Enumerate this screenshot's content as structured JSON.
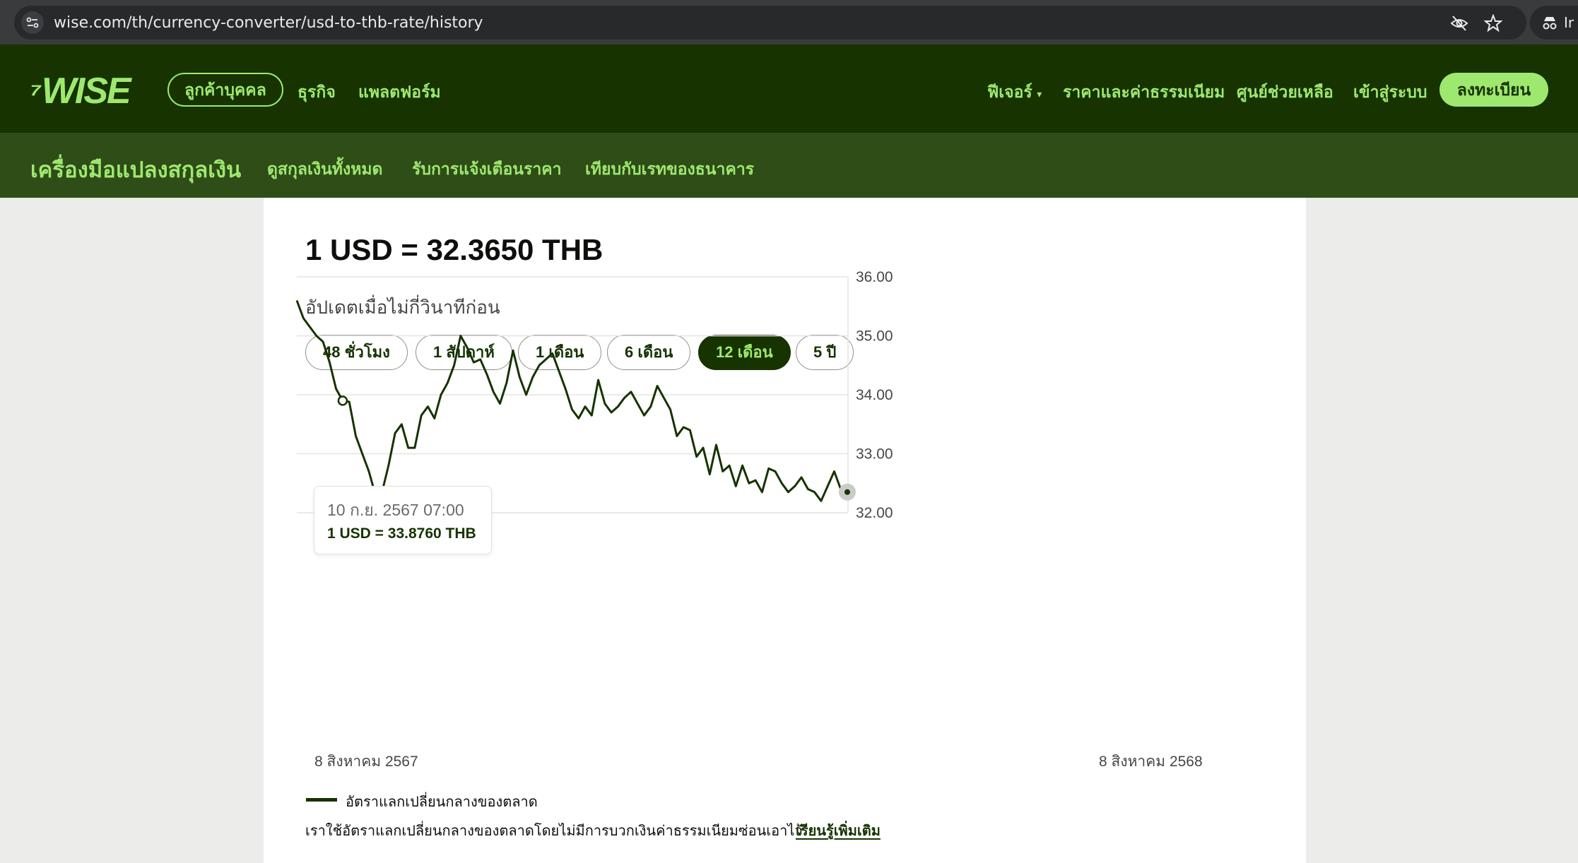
{
  "browser": {
    "url": "wise.com/th/currency-converter/usd-to-thb-rate/history",
    "profile_label": "Ir"
  },
  "nav": {
    "logo": "WISE",
    "personal": "ลูกค้าบุคคล",
    "business": "ธุรกิจ",
    "platform": "แพลตฟอร์ม",
    "features": "ฟีเจอร์",
    "pricing": "ราคาและค่าธรรมเนียม",
    "help": "ศูนย์ช่วยเหลือ",
    "login": "เข้าสู่ระบบ",
    "signup": "ลงทะเบียน"
  },
  "subnav": {
    "title": "เครื่องมือแปลงสกุลเงิน",
    "all_currencies": "ดูสกุลเงินทั้งหมด",
    "alerts": "รับการแจ้งเตือนราคา",
    "compare": "เทียบกับเรทของธนาคาร"
  },
  "rate": {
    "title": "1 USD = 32.3650 THB",
    "updated": "อัปเดตเมื่อไม่กี่วินาทีก่อน"
  },
  "ranges": [
    {
      "label": "48 ชั่วโมง",
      "active": false
    },
    {
      "label": "1 สัปดาห์",
      "active": false
    },
    {
      "label": "1 เดือน",
      "active": false
    },
    {
      "label": "6 เดือน",
      "active": false
    },
    {
      "label": "12 เดือน",
      "active": true
    },
    {
      "label": "5 ปี",
      "active": false
    }
  ],
  "tooltip": {
    "date": "10 ก.ย. 2567 07:00",
    "value": "1 USD = 33.8760 THB"
  },
  "legend": "อัตราแลกเปลี่ยนกลางของตลาด",
  "note": "เราใช้อัตราแลกเปลี่ยนกลางของตลาดโดยไม่มีการบวกเงินค่าธรรมเนียมซ่อนเอาไว้",
  "learn_more": "เรียนรู้เพิ่มเติม",
  "colors": {
    "brand_dark": "#163300",
    "brand_green": "#9fe870",
    "subnav_bg": "#2e4d17"
  },
  "chart_data": {
    "type": "line",
    "title": "",
    "xlabel": "",
    "ylabel": "",
    "x_start_label": "8 สิงหาคม 2567",
    "x_end_label": "8 สิงหาคม 2568",
    "yticks": [
      "36.00",
      "35.00",
      "34.00",
      "33.00",
      "32.00"
    ],
    "ylim": [
      32,
      36
    ],
    "grid": true,
    "series": [
      {
        "name": "อัตราแลกเปลี่ยนกลางของตลาด",
        "values": [
          35.6,
          35.3,
          35.15,
          35.0,
          34.9,
          34.55,
          34.1,
          33.9,
          33.88,
          33.3,
          33.0,
          32.7,
          32.3,
          32.35,
          32.8,
          33.35,
          33.5,
          33.1,
          33.1,
          33.65,
          33.8,
          33.6,
          34.0,
          34.2,
          34.5,
          35.0,
          34.8,
          34.55,
          34.6,
          34.35,
          34.05,
          33.85,
          34.2,
          34.75,
          34.3,
          34.0,
          34.3,
          34.5,
          34.6,
          34.7,
          34.4,
          34.1,
          33.75,
          33.6,
          33.8,
          33.65,
          34.25,
          33.85,
          33.7,
          33.8,
          33.95,
          34.05,
          33.85,
          33.65,
          33.8,
          34.15,
          33.95,
          33.75,
          33.3,
          33.45,
          33.4,
          32.95,
          33.1,
          32.65,
          33.15,
          32.7,
          32.8,
          32.45,
          32.8,
          32.5,
          32.55,
          32.35,
          32.75,
          32.7,
          32.5,
          32.35,
          32.45,
          32.6,
          32.4,
          32.35,
          32.2,
          32.45,
          32.7,
          32.4,
          32.35
        ]
      }
    ]
  }
}
